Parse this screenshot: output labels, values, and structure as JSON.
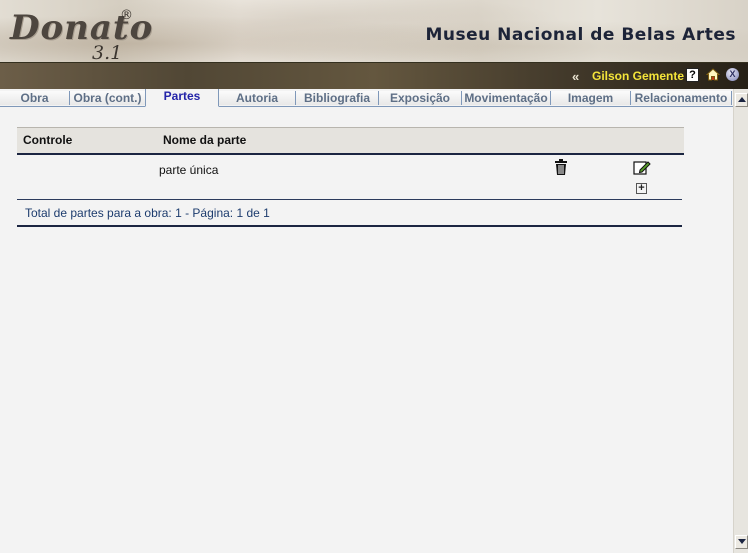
{
  "header": {
    "logo_word": "Donato",
    "logo_reg": "®",
    "logo_version": "3.1",
    "museum_name": "Museu Nacional de Belas Artes"
  },
  "userbar": {
    "back_label": "«",
    "user_name": "Gilson Gemente",
    "help_label": "?",
    "close_label": "X"
  },
  "tabs": [
    {
      "label": "Obra",
      "active": false
    },
    {
      "label": "Obra (cont.)",
      "active": false
    },
    {
      "label": "Partes",
      "active": true
    },
    {
      "label": "Autoria",
      "active": false
    },
    {
      "label": "Bibliografia",
      "active": false
    },
    {
      "label": "Exposição",
      "active": false
    },
    {
      "label": "Movimentação",
      "active": false
    },
    {
      "label": "Imagem",
      "active": false
    },
    {
      "label": "Relacionamento",
      "active": false
    }
  ],
  "table": {
    "columns": [
      "Controle",
      "Nome da parte"
    ],
    "rows": [
      {
        "controle": "",
        "nome": "parte única"
      }
    ],
    "total_text": "Total de partes para a obra: 1 - Página: 1 de 1"
  },
  "colors": {
    "accent": "#2323a8",
    "username": "#f4e43a",
    "border_dark": "#1b2541"
  }
}
